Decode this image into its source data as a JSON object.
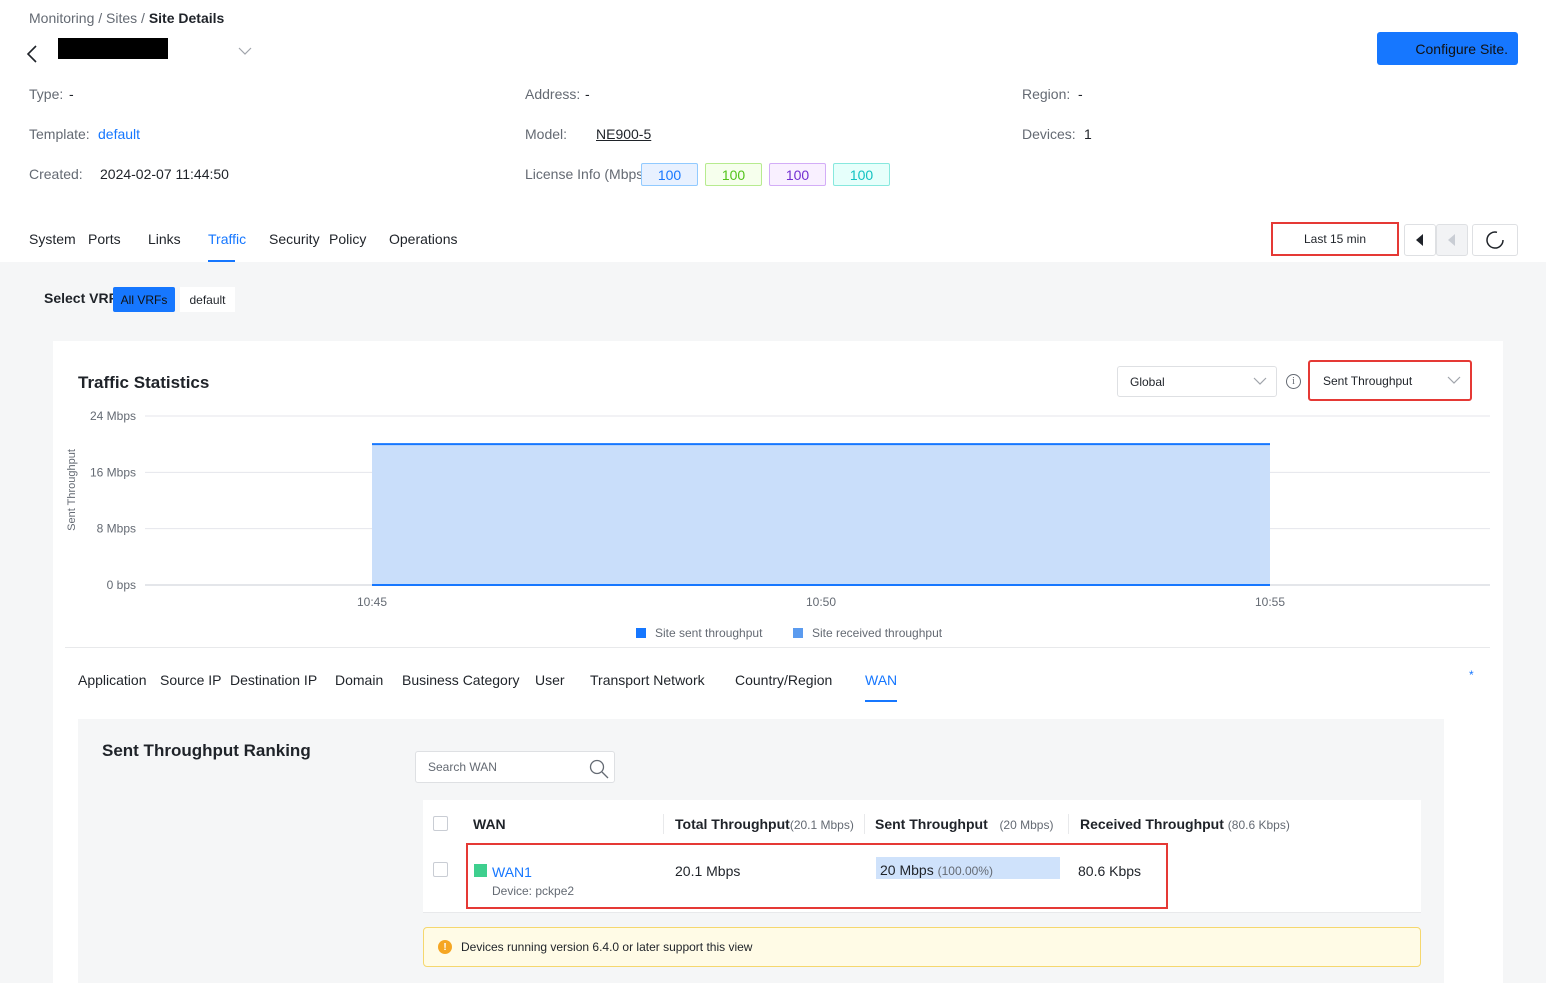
{
  "breadcrumb": {
    "part1": "Monitoring / Sites / ",
    "current": "Site Details"
  },
  "header": {
    "configure_label": "Configure Site."
  },
  "info": {
    "type_label": "Type:",
    "type_value": "-",
    "address_label": "Address:",
    "address_value": "-",
    "region_label": "Region:",
    "region_value": "-",
    "template_label": "Template:",
    "template_value": "default",
    "model_label": "Model:",
    "model_value": "NE900-5",
    "devices_label": "Devices:",
    "devices_value": "1",
    "created_label": "Created:",
    "created_value": "2024-02-07 11:44:50",
    "license_label": "License Info (Mbps",
    "license_values": [
      {
        "value": "100",
        "color": "#1677ff",
        "bg": "#e8f1ff",
        "border": "#91caff"
      },
      {
        "value": "100",
        "color": "#52c41a",
        "bg": "#f6ffed",
        "border": "#b7eb8f"
      },
      {
        "value": "100",
        "color": "#722ed1",
        "bg": "#f9f0ff",
        "border": "#d3adf7"
      },
      {
        "value": "100",
        "color": "#13c2c2",
        "bg": "#e6fffb",
        "border": "#87e8de"
      }
    ]
  },
  "tabs": [
    "System",
    "Ports",
    "Links",
    "Traffic",
    "Security",
    "Policy",
    "Operations"
  ],
  "active_tab": "Traffic",
  "time_range": "Last 15 min",
  "vrf": {
    "label": "Select VRF",
    "options": [
      "All VRFs",
      "default"
    ],
    "selected": "All VRFs"
  },
  "traffic": {
    "title": "Traffic Statistics",
    "scope_select": "Global",
    "metric_select": "Sent Throughput"
  },
  "chart_data": {
    "type": "area",
    "ylabel": "Sent Throughput",
    "y_ticks": [
      "0 bps",
      "8 Mbps",
      "16 Mbps",
      "24 Mbps"
    ],
    "ylim": [
      0,
      24
    ],
    "x_ticks": [
      "10:45",
      "10:50",
      "10:55"
    ],
    "series": [
      {
        "name": "Site sent throughput",
        "color": "#1677ff",
        "x": [
          "10:45",
          "10:55"
        ],
        "values": [
          20,
          20
        ]
      },
      {
        "name": "Site received throughput",
        "color": "#5b9bef",
        "values": []
      }
    ],
    "grid": true,
    "legend": "bottom"
  },
  "dimension_tabs": [
    "Application",
    "Source IP",
    "Destination IP",
    "Domain",
    "Business Category",
    "User",
    "Transport Network",
    "Country/Region",
    "WAN"
  ],
  "active_dimension": "WAN",
  "dimension_marker": "*",
  "ranking": {
    "title": "Sent Throughput Ranking",
    "search_placeholder": "Search WAN",
    "columns": {
      "wan": "WAN",
      "total": "Total Throughput",
      "total_sub": "(20.1 Mbps)",
      "sent": "Sent Throughput",
      "sent_sub": "(20 Mbps)",
      "received": "Received Throughput",
      "received_sub": "(80.6 Kbps)"
    },
    "rows": [
      {
        "name": "WAN1",
        "device": "Device: pckpe2",
        "total": "20.1 Mbps",
        "sent": "20 Mbps",
        "sent_pct": "(100.00%)",
        "sent_fraction": 1.0,
        "received": "80.6 Kbps"
      }
    ],
    "notice": "Devices running version 6.4.0 or later support this view"
  }
}
